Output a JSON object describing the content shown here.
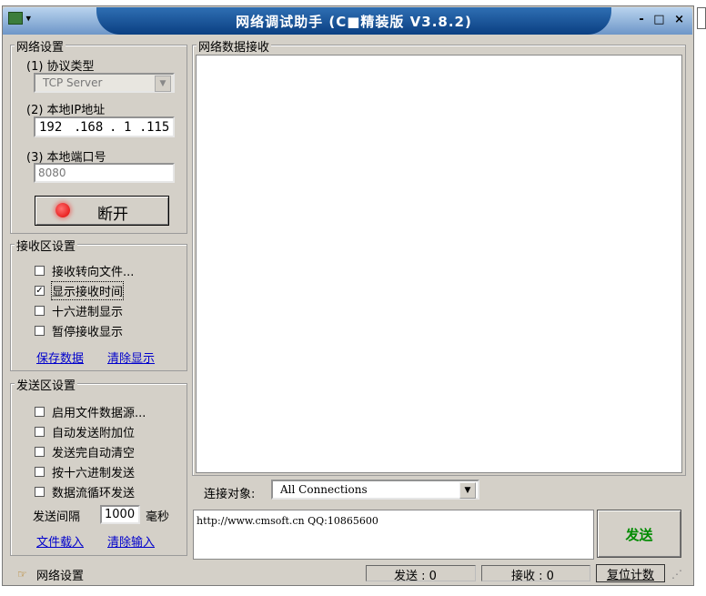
{
  "window": {
    "title": "网络调试助手 (C■精装版 V3.8.2)",
    "controls": "- □ ×"
  },
  "network_settings": {
    "group_label": "网络设置",
    "protocol_label": "(1) 协议类型",
    "protocol_value": "TCP Server",
    "ip_label": "(2) 本地IP地址",
    "ip_parts": [
      "192",
      "168",
      "1",
      "115"
    ],
    "port_label": "(3) 本地端口号",
    "port_value": "8080",
    "disconnect_label": "断开"
  },
  "receive_settings": {
    "group_label": "接收区设置",
    "options": [
      {
        "label": "接收转向文件...",
        "checked": false
      },
      {
        "label": "显示接收时间",
        "checked": true
      },
      {
        "label": "十六进制显示",
        "checked": false
      },
      {
        "label": "暂停接收显示",
        "checked": false
      }
    ],
    "save_link": "保存数据",
    "clear_link": "清除显示"
  },
  "send_settings": {
    "group_label": "发送区设置",
    "options": [
      {
        "label": "启用文件数据源...",
        "checked": false
      },
      {
        "label": "自动发送附加位",
        "checked": false
      },
      {
        "label": "发送完自动清空",
        "checked": false
      },
      {
        "label": "按十六进制发送",
        "checked": false
      },
      {
        "label": "数据流循环发送",
        "checked": false
      }
    ],
    "interval_label": "发送间隔",
    "interval_value": "1000",
    "interval_unit": "毫秒",
    "load_file_link": "文件载入",
    "clear_input_link": "清除输入"
  },
  "receive_area": {
    "group_label": "网络数据接收"
  },
  "connection": {
    "label": "连接对象:",
    "value": "All Connections"
  },
  "send_area": {
    "text": "http://www.cmsoft.cn QQ:10865600",
    "send_button": "发送"
  },
  "statusbar": {
    "label": "网络设置",
    "sent": "发送 : 0",
    "received": "接收 : 0",
    "reset_button": "复位计数"
  }
}
